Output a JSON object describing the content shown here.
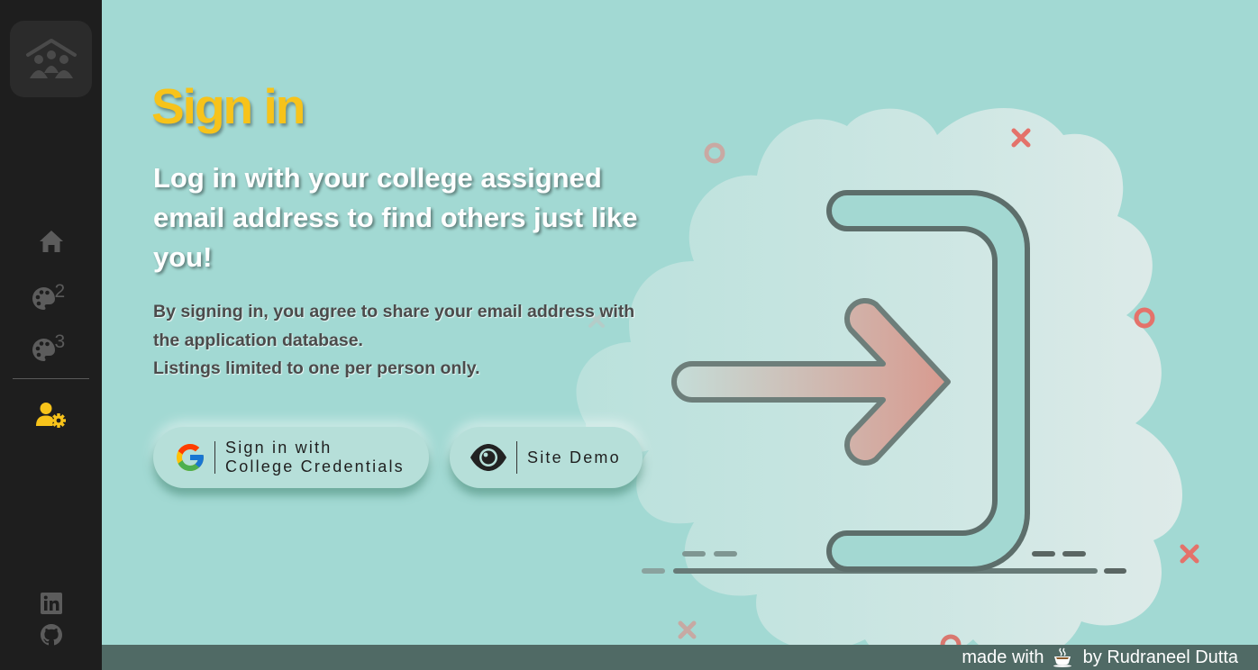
{
  "sidebar": {
    "logo_icon": "family-house-icon",
    "nav": [
      {
        "name": "home",
        "icon": "home-icon"
      },
      {
        "name": "palette-2",
        "icon": "palette-icon",
        "superscript": "2"
      },
      {
        "name": "palette-3",
        "icon": "palette-icon",
        "superscript": "3"
      },
      {
        "name": "user-settings",
        "icon": "user-gear-icon",
        "active": true
      }
    ],
    "social": [
      {
        "name": "linkedin",
        "icon": "linkedin-icon"
      },
      {
        "name": "github",
        "icon": "github-icon"
      }
    ]
  },
  "main": {
    "title": "Sign in",
    "subtitle": "Log in with your college assigned email address to find others just like you!",
    "note_line1": "By signing in, you agree to share your email address with the application database.",
    "note_line2": "Listings limited to one per person only.",
    "google_button_label": "Sign in with\nCollege Credentials",
    "demo_button_label": "Site Demo"
  },
  "footer": {
    "prefix": "made with",
    "icon": "coffee-cup-icon",
    "suffix": "by Rudraneel Dutta"
  },
  "colors": {
    "background": "#a2d9d3",
    "sidebar": "#1e1e1e",
    "accent": "#f7c31a",
    "footer": "#506a65"
  }
}
